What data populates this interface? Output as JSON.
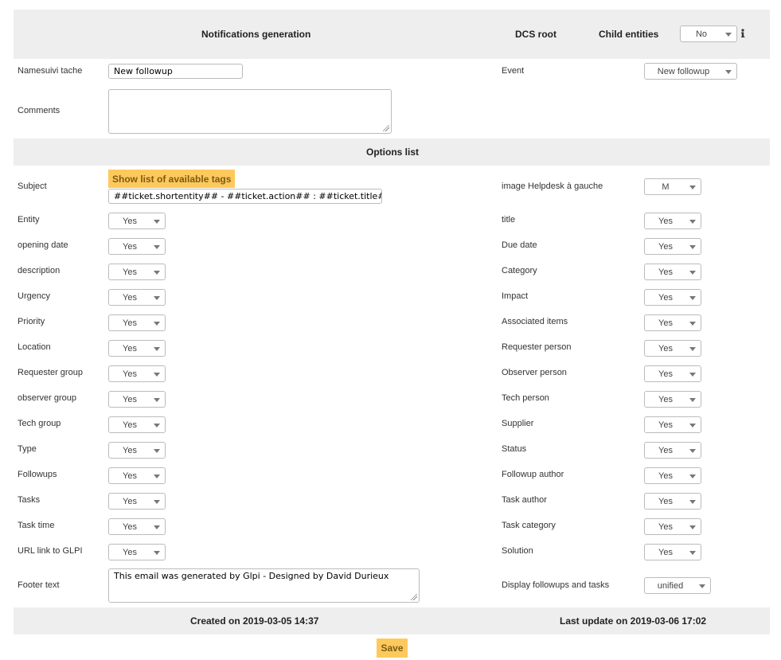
{
  "header": {
    "title": "Notifications generation",
    "dcs_root": "DCS root",
    "child_entities_label": "Child entities",
    "child_entities_value": "No"
  },
  "form": {
    "name_label": "Namesuivi tache",
    "name_value": "New followup",
    "event_label": "Event",
    "event_value": "New followup",
    "comments_label": "Comments",
    "comments_value": ""
  },
  "options": {
    "title": "Options list",
    "subject_label": "Subject",
    "show_tags_label": "Show list of available tags",
    "subject_value": "##ticket.shortentity## - ##ticket.action## : ##ticket.title##",
    "image_label": "image Helpdesk à gauche",
    "image_value": "M",
    "left": [
      {
        "label": "Entity",
        "value": "Yes"
      },
      {
        "label": "opening date",
        "value": "Yes"
      },
      {
        "label": "description",
        "value": "Yes"
      },
      {
        "label": "Urgency",
        "value": "Yes"
      },
      {
        "label": "Priority",
        "value": "Yes"
      },
      {
        "label": "Location",
        "value": "Yes"
      },
      {
        "label": "Requester group",
        "value": "Yes"
      },
      {
        "label": "observer group",
        "value": "Yes"
      },
      {
        "label": "Tech group",
        "value": "Yes"
      },
      {
        "label": "Type",
        "value": "Yes"
      },
      {
        "label": "Followups",
        "value": "Yes"
      },
      {
        "label": "Tasks",
        "value": "Yes"
      },
      {
        "label": "Task time",
        "value": "Yes"
      },
      {
        "label": "URL link to GLPI",
        "value": "Yes"
      }
    ],
    "right": [
      {
        "label": "title",
        "value": "Yes"
      },
      {
        "label": "Due date",
        "value": "Yes"
      },
      {
        "label": "Category",
        "value": "Yes"
      },
      {
        "label": "Impact",
        "value": "Yes"
      },
      {
        "label": "Associated items",
        "value": "Yes"
      },
      {
        "label": "Requester person",
        "value": "Yes"
      },
      {
        "label": "Observer person",
        "value": "Yes"
      },
      {
        "label": "Tech person",
        "value": "Yes"
      },
      {
        "label": "Supplier",
        "value": "Yes"
      },
      {
        "label": "Status",
        "value": "Yes"
      },
      {
        "label": "Followup author",
        "value": "Yes"
      },
      {
        "label": "Task author",
        "value": "Yes"
      },
      {
        "label": "Task category",
        "value": "Yes"
      },
      {
        "label": "Solution",
        "value": "Yes"
      }
    ],
    "footer_label": "Footer text",
    "footer_value": "This email was generated by Glpi - Designed by David Durieux",
    "display_label": "Display followups and tasks",
    "display_value": "unified"
  },
  "footer": {
    "created": "Created on 2019-03-05 14:37",
    "updated": "Last update on 2019-03-06 17:02",
    "save_label": "Save"
  },
  "icons": {
    "info": "info-icon",
    "caret": "chevron-down-icon",
    "resize": "resize-grip-icon"
  },
  "colors": {
    "accent": "#fec95c",
    "accent_text": "#7b5a12",
    "band": "#eeeeee"
  }
}
